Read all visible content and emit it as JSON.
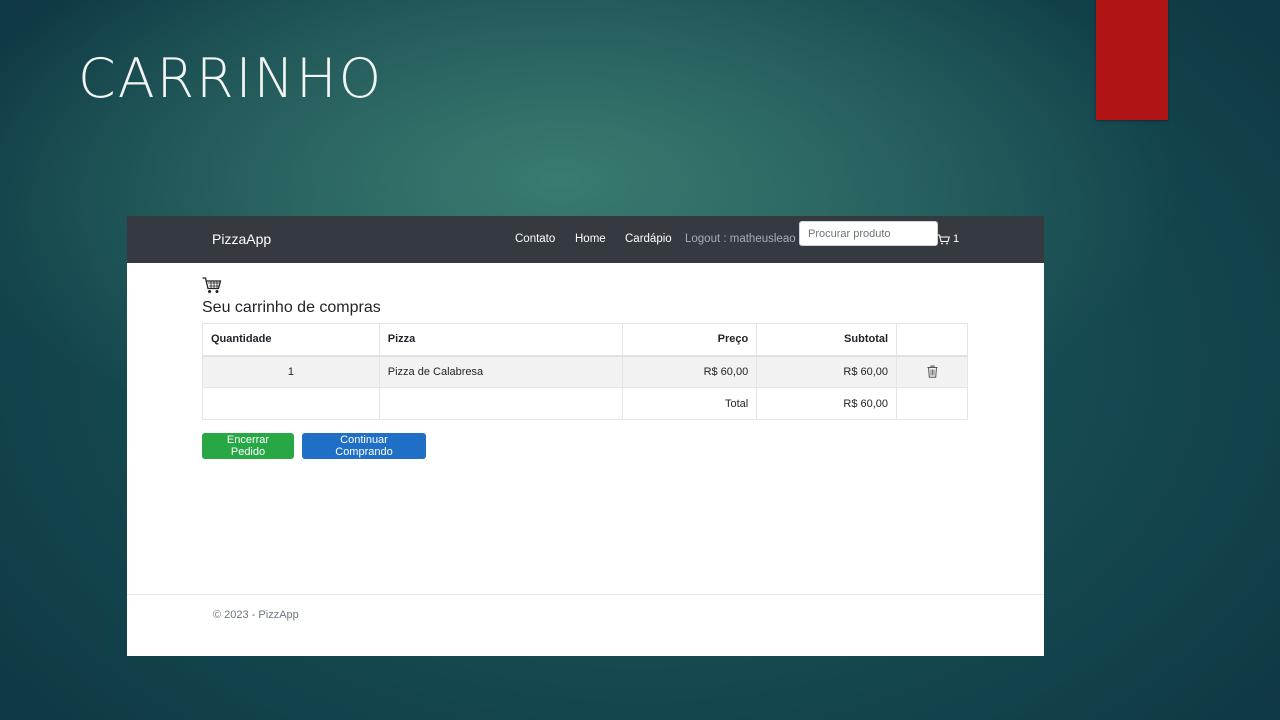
{
  "slide": {
    "title": "CARRINHO"
  },
  "navbar": {
    "brand": "PizzaApp",
    "links": [
      "Contato",
      "Home",
      "Cardápio"
    ],
    "logout": "Logout : matheusleao",
    "search_placeholder": "Procurar produto",
    "cart_count": "1"
  },
  "cart": {
    "heading": "Seu carrinho de compras",
    "columns": [
      "Quantidade",
      "Pizza",
      "Preço",
      "Subtotal"
    ],
    "items": [
      {
        "quantity": "1",
        "pizza": "Pizza de Calabresa",
        "price": "R$ 60,00",
        "subtotal": "R$ 60,00"
      }
    ],
    "total_label": "Total",
    "total_value": "R$ 60,00"
  },
  "buttons": {
    "finish": "Encerrar Pedido",
    "continue": "Continuar Comprando"
  },
  "footer": {
    "text": "© 2023 - PizzApp"
  },
  "colors": {
    "navbar": "#343a40",
    "finish_button": "#28a745",
    "continue_button": "#1f6fc6",
    "slide_accent": "#b01414"
  }
}
